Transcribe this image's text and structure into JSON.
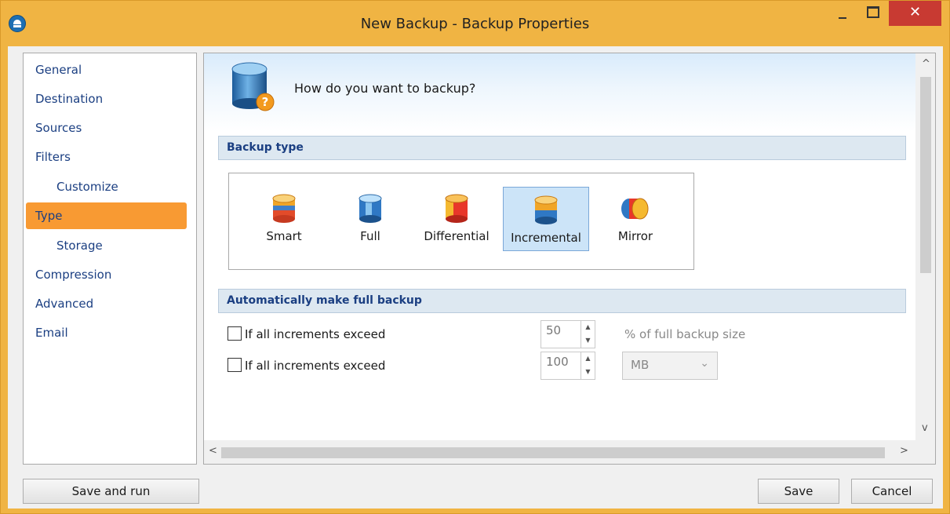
{
  "window": {
    "title": "New Backup - Backup Properties",
    "close_glyph": "✕",
    "accent_color": "#f0b443",
    "close_color": "#c83a32"
  },
  "sidebar": {
    "items": [
      {
        "label": "General"
      },
      {
        "label": "Destination"
      },
      {
        "label": "Sources"
      },
      {
        "label": "Filters"
      },
      {
        "label": "Customize"
      },
      {
        "label": "Type"
      },
      {
        "label": "Storage"
      },
      {
        "label": "Compression"
      },
      {
        "label": "Advanced"
      },
      {
        "label": "Email"
      }
    ],
    "selected": "Type",
    "selected_color": "#f89a33"
  },
  "main": {
    "header": {
      "question": "How do you want to backup?",
      "icon": "backup-question-icon"
    },
    "backup_type": {
      "section_title": "Backup type",
      "options": [
        {
          "label": "Smart",
          "icon": "smart-backup-icon"
        },
        {
          "label": "Full",
          "icon": "full-backup-icon"
        },
        {
          "label": "Differential",
          "icon": "differential-backup-icon"
        },
        {
          "label": "Incremental",
          "icon": "incremental-backup-icon"
        },
        {
          "label": "Mirror",
          "icon": "mirror-backup-icon"
        }
      ],
      "selected": "Incremental"
    },
    "auto_full": {
      "section_title": "Automatically make full backup",
      "rows": [
        {
          "label": "If all increments exceed",
          "checked": false,
          "value": "50",
          "suffix": "% of full backup size"
        },
        {
          "label": "If all increments exceed",
          "checked": false,
          "value": "100",
          "unit": "MB"
        }
      ]
    }
  },
  "scroll": {
    "up": "^",
    "down": "v",
    "left": "<",
    "right": ">"
  },
  "buttons": {
    "save_and_run": "Save and run",
    "save": "Save",
    "cancel": "Cancel"
  }
}
